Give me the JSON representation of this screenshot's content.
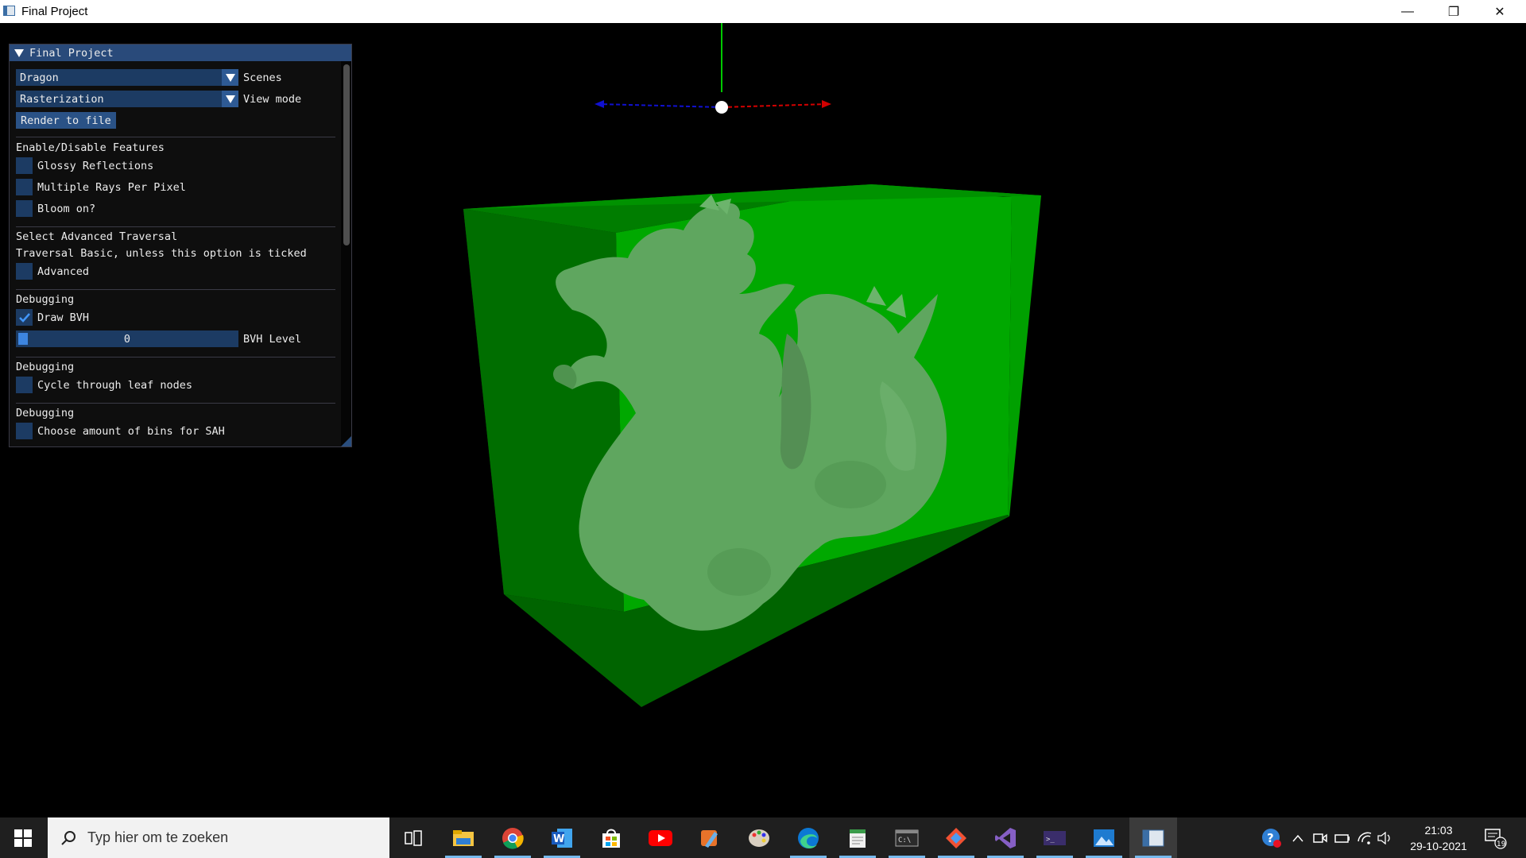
{
  "window": {
    "title": "Final Project",
    "minimize_glyph": "—",
    "maximize_glyph": "❐",
    "close_glyph": "✕"
  },
  "panel": {
    "title": "Final Project",
    "scene_select": {
      "value": "Dragon",
      "label": "Scenes"
    },
    "view_mode_select": {
      "value": "Rasterization",
      "label": "View mode"
    },
    "render_button": "Render to file",
    "features": {
      "heading": "Enable/Disable Features",
      "glossy": {
        "label": "Glossy Reflections",
        "checked": false
      },
      "multi_rays": {
        "label": "Multiple Rays Per Pixel",
        "checked": false
      },
      "bloom": {
        "label": "Bloom on?",
        "checked": false
      }
    },
    "traversal": {
      "heading": "Select Advanced Traversal",
      "note": "Traversal Basic, unless this option is ticked",
      "advanced": {
        "label": "Advanced",
        "checked": false
      }
    },
    "debug_bvh": {
      "heading": "Debugging",
      "draw_bvh": {
        "label": "Draw BVH",
        "checked": true
      },
      "bvh_level": {
        "value": "0",
        "label": "BVH Level"
      }
    },
    "debug_leaf": {
      "heading": "Debugging",
      "cycle": {
        "label": "Cycle through leaf nodes",
        "checked": false
      }
    },
    "debug_sah": {
      "heading": "Debugging",
      "bins": {
        "label": "Choose amount of bins for SAH",
        "checked": false
      }
    }
  },
  "taskbar": {
    "search_placeholder": "Typ hier om te zoeken",
    "time": "21:03",
    "date": "29-10-2021",
    "notification_count": "19",
    "icons": [
      "task-view-icon",
      "file-explorer-icon",
      "chrome-icon",
      "word-icon",
      "store-icon",
      "youtube-icon",
      "paint-app-icon",
      "paint-palette-icon",
      "edge-icon",
      "notepad-icon",
      "terminal-icon",
      "git-icon",
      "visual-studio-icon",
      "powershell-icon",
      "photos-icon",
      "final-project-app-icon"
    ]
  },
  "colors": {
    "panel_bg": "#0f0f0f",
    "panel_header": "#294a7a",
    "frame_bg": "#1c3b63",
    "button": "#2a5286",
    "checkmark": "#4296fa",
    "box_front": "#007a00",
    "box_back": "#00a800",
    "dragon": "#5fa65f",
    "axis_x": "#d20000",
    "axis_y": "#00c800",
    "axis_z": "#1010d0"
  }
}
